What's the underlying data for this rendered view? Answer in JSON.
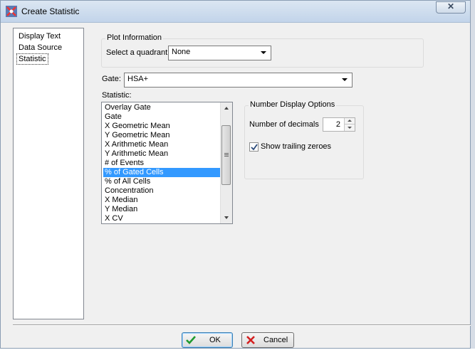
{
  "window": {
    "title": "Create Statistic",
    "close_label": "✕"
  },
  "sidebar": {
    "items": [
      {
        "label": "Display Text"
      },
      {
        "label": "Data Source"
      },
      {
        "label": "Statistic"
      }
    ]
  },
  "plot_info": {
    "title": "Plot Information",
    "quadrant_label": "Select a quadrant",
    "quadrant_value": "None"
  },
  "gate": {
    "label": "Gate:",
    "value": "HSA+"
  },
  "statistic": {
    "label": "Statistic:",
    "items": [
      "Overlay Gate",
      "Gate",
      "X Geometric Mean",
      "Y Geometric Mean",
      "X Arithmetic Mean",
      "Y Arithmetic Mean",
      "# of Events",
      "% of Gated Cells",
      "% of All Cells",
      "Concentration",
      "X Median",
      "Y Median",
      "X CV"
    ],
    "selected": "% of Gated Cells"
  },
  "number_display": {
    "title": "Number Display Options",
    "decimals_label": "Number of decimals",
    "decimals_value": "2",
    "trailing_label": "Show trailing zeroes",
    "trailing_checked": true
  },
  "buttons": {
    "ok": "OK",
    "cancel": "Cancel"
  }
}
